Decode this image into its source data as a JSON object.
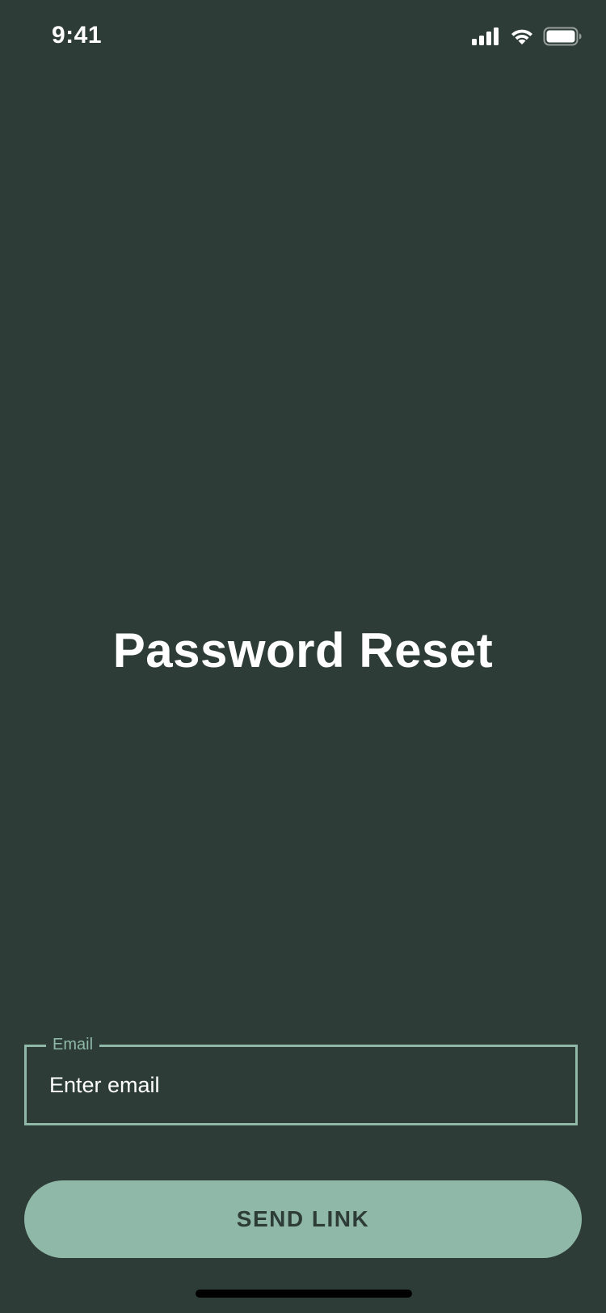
{
  "status_bar": {
    "time": "9:41",
    "icons": [
      "signal-icon",
      "wifi-icon",
      "battery-icon"
    ]
  },
  "page": {
    "title": "Password Reset"
  },
  "email_field": {
    "label": "Email",
    "placeholder": "Enter email",
    "value": ""
  },
  "send_button": {
    "label": "SEND LINK"
  },
  "colors": {
    "background": "#2e3c38",
    "accent": "#8fb8a8",
    "text": "#ffffff",
    "button_text": "#2e3c38"
  }
}
